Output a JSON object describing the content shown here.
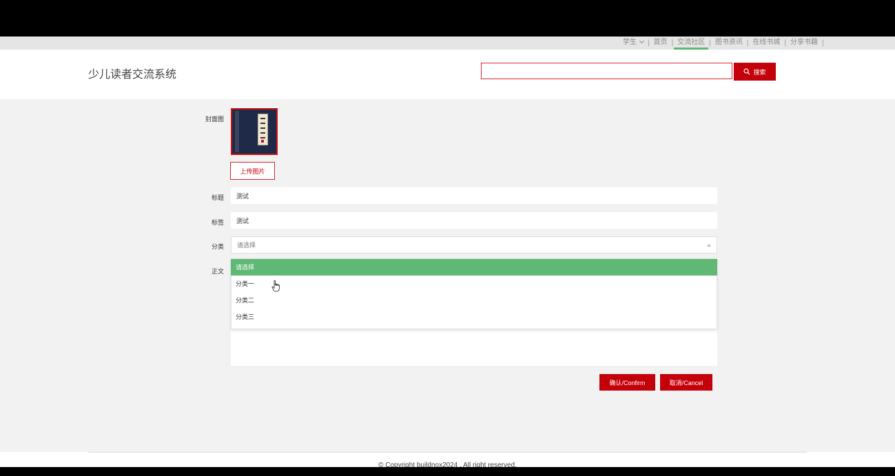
{
  "topnav": {
    "role": "学生",
    "items": [
      "首页",
      "交流社区",
      "图书资讯",
      "在线书城",
      "分享书籍"
    ],
    "active_index": 1,
    "accent": "#5cb874"
  },
  "header": {
    "site_title": "少儿读者交流系统",
    "search_placeholder": "",
    "search_label": "搜索",
    "brand_red": "#c4000a"
  },
  "form": {
    "cover_label": "封面图",
    "upload_label": "上传图片",
    "title_label": "标题",
    "title_value": "测试",
    "tag_label": "标签",
    "tag_value": "测试",
    "category_label": "分类",
    "category_value": "请选择",
    "body_label": "正文",
    "category_options": [
      "请选择",
      "分类一",
      "分类二",
      "分类三"
    ],
    "category_highlighted": "请选择",
    "confirm_label": "确认/Confirm",
    "cancel_label": "取消/Cancel"
  },
  "footer": {
    "copyright": "© Copyright buildnox2024 . All right reserved."
  }
}
